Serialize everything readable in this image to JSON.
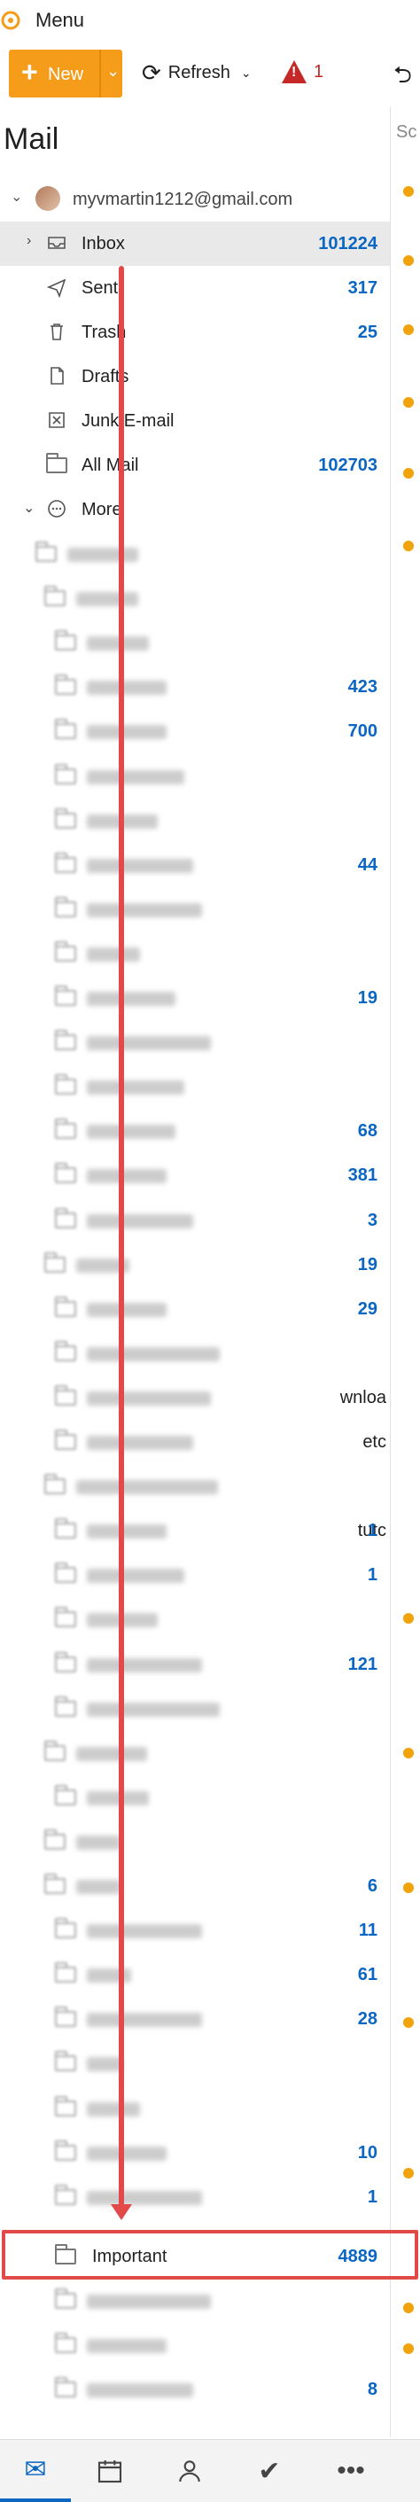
{
  "menubar": {
    "menu_label": "Menu",
    "brand_color": "#f59c1a"
  },
  "toolbar": {
    "new_label": "New",
    "refresh_label": "Refresh",
    "alert_count": "1"
  },
  "sidebar": {
    "heading": "Mail",
    "account_email": "myvmartin1212@gmail.com",
    "folders": [
      {
        "name": "Inbox",
        "count": "101224",
        "icon": "inbox-icon"
      },
      {
        "name": "Sent",
        "count": "317",
        "icon": "send-icon"
      },
      {
        "name": "Trash",
        "count": "25",
        "icon": "trash-icon"
      },
      {
        "name": "Drafts",
        "count": "",
        "icon": "draft-icon"
      },
      {
        "name": "Junk E-mail",
        "count": "",
        "icon": "junk-icon"
      },
      {
        "name": "All Mail",
        "count": "102703",
        "icon": "folder-icon"
      },
      {
        "name": "More",
        "count": "",
        "icon": "more-circle-icon"
      }
    ],
    "blurred_counts": [
      "",
      "",
      "",
      "423",
      "700",
      "",
      "",
      "44",
      "",
      "",
      "19",
      "",
      "",
      "68",
      "381",
      "3",
      "19",
      "29",
      "",
      "",
      "",
      "",
      "1",
      "1",
      "",
      "121",
      "",
      "",
      "",
      "",
      "6",
      "11",
      "61",
      "28",
      "",
      "",
      "10",
      "1"
    ],
    "blurred_tails": {
      "19": "wnloa",
      "20": "etc",
      "22": "tutc"
    },
    "important": {
      "name": "Important",
      "count": "4889"
    },
    "after_counts": [
      "",
      "",
      "8"
    ]
  },
  "right_strip": {
    "partial_text": "Sc"
  },
  "bottom_nav": [
    "mail-icon",
    "calendar-icon",
    "people-icon",
    "tasks-icon",
    "more-icon"
  ]
}
